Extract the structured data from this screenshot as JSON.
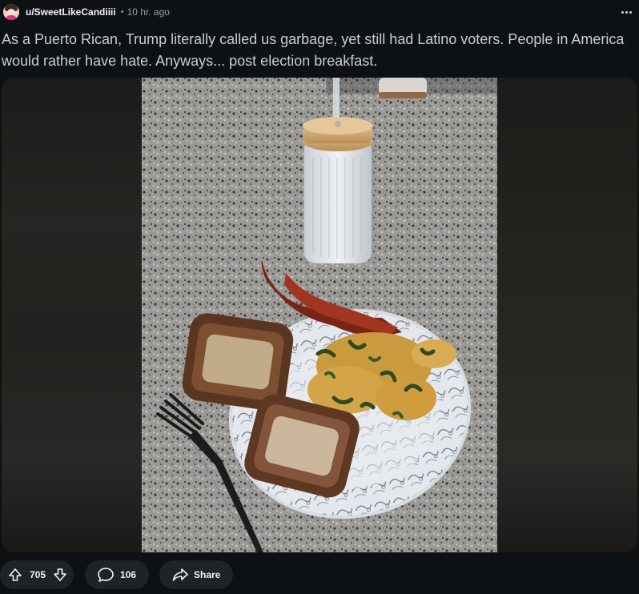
{
  "post": {
    "username": "u/SweetLikeCandiiii",
    "separator": "•",
    "time": "10 hr. ago",
    "title": "As a Puerto Rican, Trump literally called us garbage, yet still had Latino voters. People in America would rather have hate. Anyways... post election breakfast."
  },
  "actions": {
    "upvotes": "705",
    "comments": "106",
    "share_label": "Share"
  },
  "icons": {
    "avatar": "user-avatar-icon",
    "more": "more-options-icon",
    "upvote": "arrow-up-icon",
    "downvote": "arrow-down-icon",
    "comment": "comment-bubble-icon",
    "share": "share-arrow-icon"
  },
  "colors": {
    "background": "#0e1113",
    "pill": "#1f2326",
    "text": "#d7dadc",
    "meta": "#8ba2ad"
  }
}
